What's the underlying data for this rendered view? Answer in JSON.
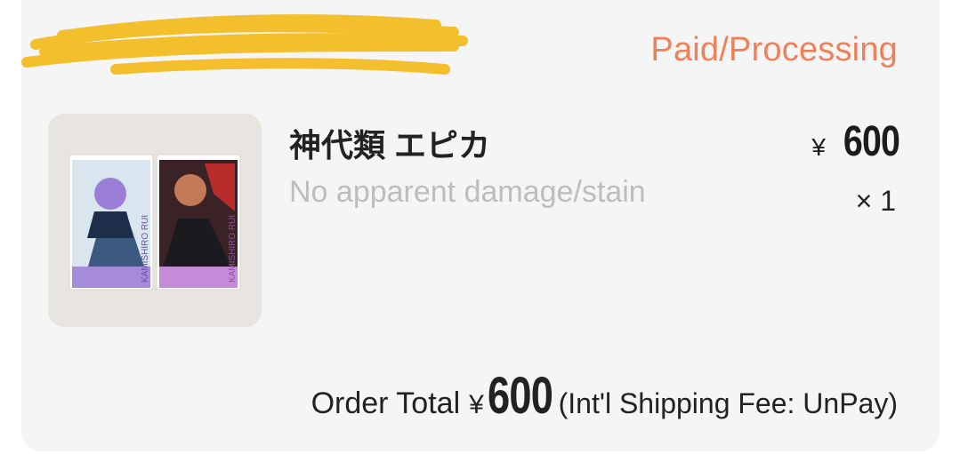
{
  "order": {
    "status": "Paid/Processing"
  },
  "item": {
    "title": "神代類 エピカ",
    "condition": "No apparent damage/stain",
    "currency": "¥",
    "price": "600",
    "quantity": "× 1",
    "image_cards": [
      {
        "name_text": "KAMISHIRO RUI",
        "color": "#a58bd8"
      },
      {
        "name_text": "KAMISHIRO RUI",
        "color": "#c68bd8"
      }
    ]
  },
  "summary": {
    "label": "Order Total",
    "currency": "¥",
    "amount": "600",
    "shipping_note": "(Int'l Shipping Fee: UnPay)"
  },
  "colors": {
    "status": "#f08057",
    "redaction": "#f3bf2d"
  }
}
